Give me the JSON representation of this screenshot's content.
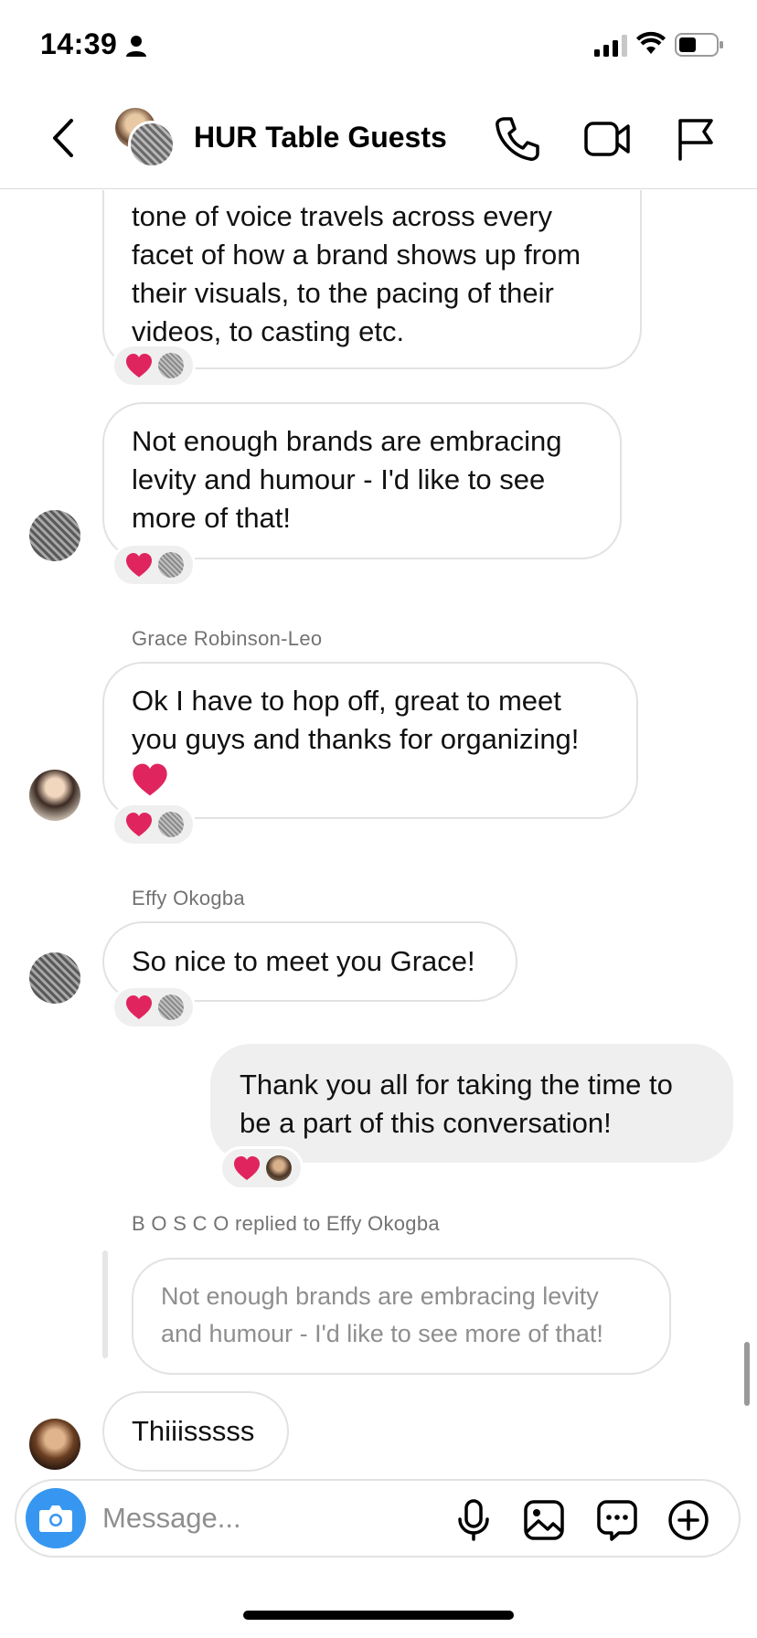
{
  "status_bar": {
    "time": "14:39",
    "icons": [
      "person-icon",
      "signal-icon",
      "wifi-icon",
      "battery-icon"
    ]
  },
  "header": {
    "title": "HUR Table Guests",
    "icons": [
      "back-chevron-icon",
      "group-avatar",
      "phone-icon",
      "video-icon",
      "flag-icon"
    ]
  },
  "messages": [
    {
      "text_lines": [
        "tone of voice travels across every",
        "facet of how a brand shows up from",
        "their visuals, to the pacing of their",
        "videos, to casting etc."
      ],
      "reactions": [
        "heart",
        "avatar"
      ]
    },
    {
      "text_lines": [
        "Not enough brands are embracing",
        "levity and humour - I'd like to see",
        "more of that!"
      ],
      "reactions": [
        "heart",
        "avatar"
      ]
    },
    {
      "sender": "Grace Robinson-Leo",
      "text_lines": [
        "Ok I have to hop off, great to meet",
        "you guys and thanks for organizing!"
      ],
      "emoji": "heart",
      "reactions": [
        "heart",
        "avatar"
      ]
    },
    {
      "sender": "Effy Okogba",
      "text_lines": [
        "So nice to meet you Grace!"
      ],
      "reactions": [
        "heart",
        "avatar"
      ]
    },
    {
      "outgoing": true,
      "text_lines": [
        "Thank you all for taking the time to",
        "be a part of this conversation!"
      ],
      "reactions": [
        "heart",
        "avatar"
      ]
    },
    {
      "sender": "B O S C O replied to Effy Okogba",
      "quoted_lines": [
        "Not enough brands are embracing levity",
        "and humour - I'd like to see more of that!"
      ],
      "text_lines": [
        "Thiiisssss"
      ]
    }
  ],
  "composer": {
    "placeholder": "Message...",
    "icons": [
      "camera-icon",
      "microphone-icon",
      "gallery-icon",
      "sticker-icon",
      "plus-icon"
    ]
  },
  "colors": {
    "accent": "#3797f0",
    "heart": "#e0245e",
    "incoming_bubble_border": "#e2e2e2",
    "outgoing_bubble_bg": "#efefef",
    "meta_text": "#737373"
  }
}
